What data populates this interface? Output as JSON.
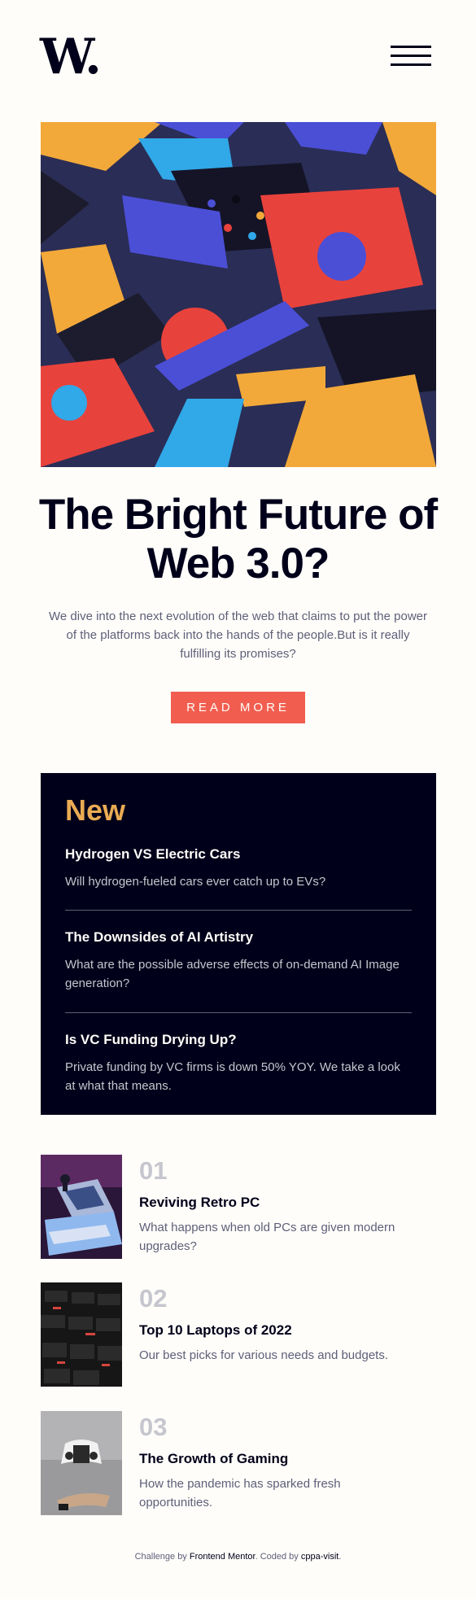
{
  "header": {
    "logo": "W."
  },
  "hero": {
    "title": "The Bright Future of Web 3.0?",
    "description": "We dive into the next evolution of the web that claims to put the power of the platforms back into the hands of the people.But is it really fulfilling its promises?",
    "button_label": "READ MORE"
  },
  "new_section": {
    "heading": "New",
    "items": [
      {
        "title": "Hydrogen VS Electric Cars",
        "description": "Will hydrogen-fueled cars ever catch up to EVs?"
      },
      {
        "title": "The Downsides of AI Artistry",
        "description": "What are the possible adverse effects of on-demand AI Image generation?"
      },
      {
        "title": "Is VC Funding Drying Up?",
        "description": "Private funding by VC firms is down 50% YOY. We take a look at what that means."
      }
    ]
  },
  "trending": [
    {
      "number": "01",
      "title": "Reviving Retro PC",
      "description": "What happens when old PCs are given modern upgrades?"
    },
    {
      "number": "02",
      "title": "Top 10 Laptops of 2022",
      "description": "Our best picks for various needs and budgets."
    },
    {
      "number": "03",
      "title": "The Growth of Gaming",
      "description": "How the pandemic has sparked fresh opportunities."
    }
  ],
  "footer": {
    "prefix": "Challenge by",
    "challenge_link": "Frontend Mentor",
    "coded_by": ". Coded by",
    "author_link": "cppa-visit",
    "suffix": "."
  },
  "colors": {
    "background": "#fffdf9",
    "dark": "#00001a",
    "accent_red": "#f15e50",
    "accent_orange": "#e9ab53",
    "muted": "#5d5f79",
    "light_grey": "#c5c6ce"
  }
}
